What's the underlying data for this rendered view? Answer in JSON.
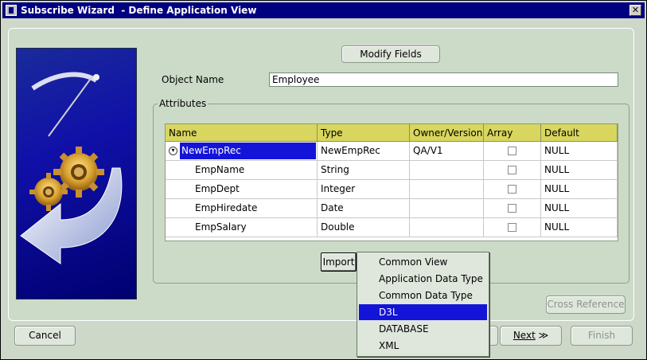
{
  "window": {
    "title": "Subscribe Wizard  - Define Application View"
  },
  "buttons": {
    "modify_fields": "Modify Fields",
    "import": "Import",
    "cross_reference": "Cross Reference",
    "cancel": "Cancel",
    "next": "Next",
    "next_arrow": "≫",
    "finish": "Finish"
  },
  "form": {
    "object_name_label": "Object Name",
    "object_name_value": "Employee"
  },
  "attributes": {
    "group_title": "Attributes",
    "columns": [
      "Name",
      "Type",
      "Owner/Version",
      "Array",
      "Default"
    ],
    "rows": [
      {
        "name": "NewEmpRec",
        "type": "NewEmpRec",
        "owner": "QA/V1",
        "array": false,
        "default": "NULL"
      },
      {
        "name": "EmpName",
        "type": "String",
        "owner": "",
        "array": false,
        "default": "NULL"
      },
      {
        "name": "EmpDept",
        "type": "Integer",
        "owner": "",
        "array": false,
        "default": "NULL"
      },
      {
        "name": "EmpHiredate",
        "type": "Date",
        "owner": "",
        "array": false,
        "default": "NULL"
      },
      {
        "name": "EmpSalary",
        "type": "Double",
        "owner": "",
        "array": false,
        "default": "NULL"
      }
    ]
  },
  "import_menu": {
    "items": [
      "Common View",
      "Application Data Type",
      "Common Data Type",
      "D3L",
      "DATABASE",
      "XML"
    ],
    "selected": "D3L"
  },
  "colors": {
    "titlebar": "#000080",
    "header": "#d8d65e",
    "selection": "#1414d8",
    "panel": "#ccdbc8"
  }
}
